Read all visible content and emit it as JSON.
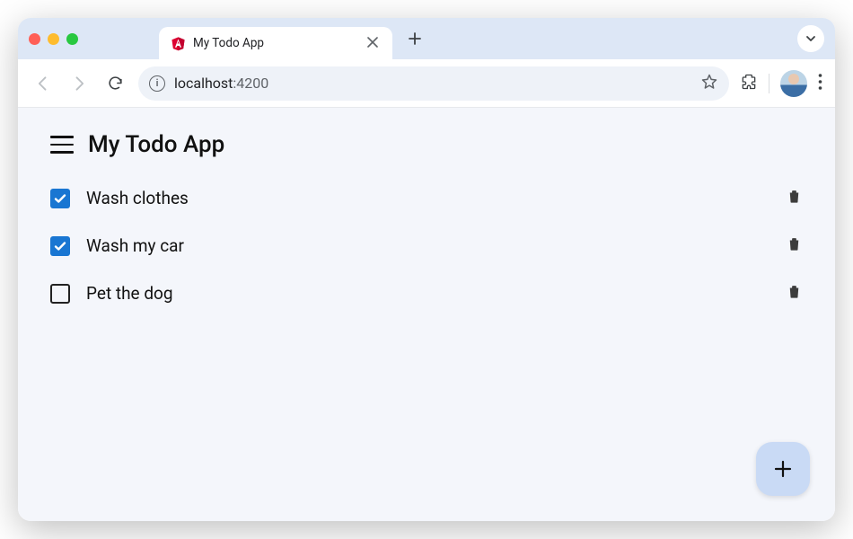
{
  "browser": {
    "tab_title": "My Todo App",
    "url_host": "localhost",
    "url_port": ":4200"
  },
  "app": {
    "title": "My Todo App"
  },
  "todos": [
    {
      "label": "Wash clothes",
      "checked": true
    },
    {
      "label": "Wash my car",
      "checked": true
    },
    {
      "label": "Pet the dog",
      "checked": false
    }
  ],
  "colors": {
    "accent": "#1976d2",
    "fab_bg": "#c9daf5",
    "page_bg": "#f4f6fb",
    "tabstrip_bg": "#dde7f6"
  }
}
